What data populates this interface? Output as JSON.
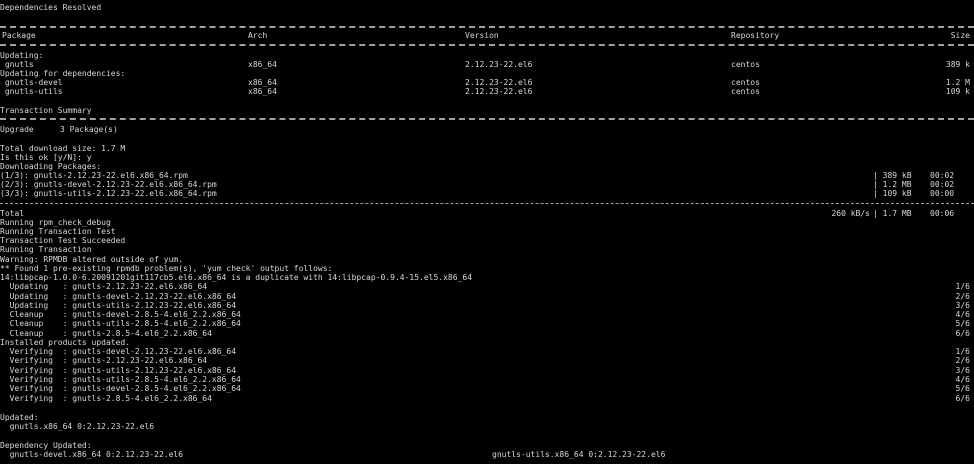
{
  "title": "Dependencies Resolved",
  "table": {
    "headers": {
      "package": "Package",
      "arch": "Arch",
      "version": "Version",
      "repository": "Repository",
      "size": "Size"
    },
    "updating_label": "Updating:",
    "updating_rows": [
      {
        "package": " gnutls",
        "arch": "x86_64",
        "version": "2.12.23-22.el6",
        "repository": "centos",
        "size": "389 k"
      }
    ],
    "deps_label": "Updating for dependencies:",
    "deps_rows": [
      {
        "package": " gnutls-devel",
        "arch": "x86_64",
        "version": "2.12.23-22.el6",
        "repository": "centos",
        "size": "1.2 M"
      },
      {
        "package": " gnutls-utils",
        "arch": "x86_64",
        "version": "2.12.23-22.el6",
        "repository": "centos",
        "size": "109 k"
      }
    ]
  },
  "summary": {
    "title": "Transaction Summary",
    "upgrade_label": "Upgrade",
    "upgrade_count": "3 Package(s)"
  },
  "download": {
    "size_line": "Total download size: 1.7 M",
    "prompt_line": "Is this ok [y/N]: y",
    "downloading_line": "Downloading Packages:",
    "files": [
      {
        "name": "(1/3): gnutls-2.12.23-22.el6.x86_64.rpm",
        "size": "| 389 kB",
        "time": "00:02"
      },
      {
        "name": "(2/3): gnutls-devel-2.12.23-22.el6.x86_64.rpm",
        "size": "| 1.2 MB",
        "time": "00:02"
      },
      {
        "name": "(3/3): gnutls-utils-2.12.23-22.el6.x86_64.rpm",
        "size": "| 109 kB",
        "time": "00:00"
      }
    ],
    "total": {
      "label": "Total",
      "speed": "260 kB/s",
      "size": "| 1.7 MB",
      "time": "00:06"
    }
  },
  "log_lines": [
    "Running rpm_check_debug",
    "Running Transaction Test",
    "Transaction Test Succeeded",
    "Running Transaction",
    "Warning: RPMDB altered outside of yum.",
    "** Found 1 pre-existing rpmdb problem(s), 'yum check' output follows:",
    "14:libpcap-1.0.0-6.20091201git117cb5.el6.x86_64 is a duplicate with 14:libpcap-0.9.4-15.el5.x86_64"
  ],
  "steps": [
    {
      "text": "  Updating   : gnutls-2.12.23-22.el6.x86_64",
      "count": "1/6"
    },
    {
      "text": "  Updating   : gnutls-devel-2.12.23-22.el6.x86_64",
      "count": "2/6"
    },
    {
      "text": "  Updating   : gnutls-utils-2.12.23-22.el6.x86_64",
      "count": "3/6"
    },
    {
      "text": "  Cleanup    : gnutls-devel-2.8.5-4.el6_2.2.x86_64",
      "count": "4/6"
    },
    {
      "text": "  Cleanup    : gnutls-utils-2.8.5-4.el6_2.2.x86_64",
      "count": "5/6"
    },
    {
      "text": "  Cleanup    : gnutls-2.8.5-4.el6_2.2.x86_64",
      "count": "6/6"
    }
  ],
  "installed_line": "Installed products updated.",
  "verify_steps": [
    {
      "text": "  Verifying  : gnutls-devel-2.12.23-22.el6.x86_64",
      "count": "1/6"
    },
    {
      "text": "  Verifying  : gnutls-2.12.23-22.el6.x86_64",
      "count": "2/6"
    },
    {
      "text": "  Verifying  : gnutls-utils-2.12.23-22.el6.x86_64",
      "count": "3/6"
    },
    {
      "text": "  Verifying  : gnutls-utils-2.8.5-4.el6_2.2.x86_64",
      "count": "4/6"
    },
    {
      "text": "  Verifying  : gnutls-devel-2.8.5-4.el6_2.2.x86_64",
      "count": "5/6"
    },
    {
      "text": "  Verifying  : gnutls-2.8.5-4.el6_2.2.x86_64",
      "count": "6/6"
    }
  ],
  "updated": {
    "label": "Updated:",
    "item": "  gnutls.x86_64 0:2.12.23-22.el6"
  },
  "dependency_updated": {
    "label": "Dependency Updated:",
    "item1": "  gnutls-devel.x86_64 0:2.12.23-22.el6",
    "item2": "gnutls-utils.x86_64 0:2.12.23-22.el6"
  }
}
